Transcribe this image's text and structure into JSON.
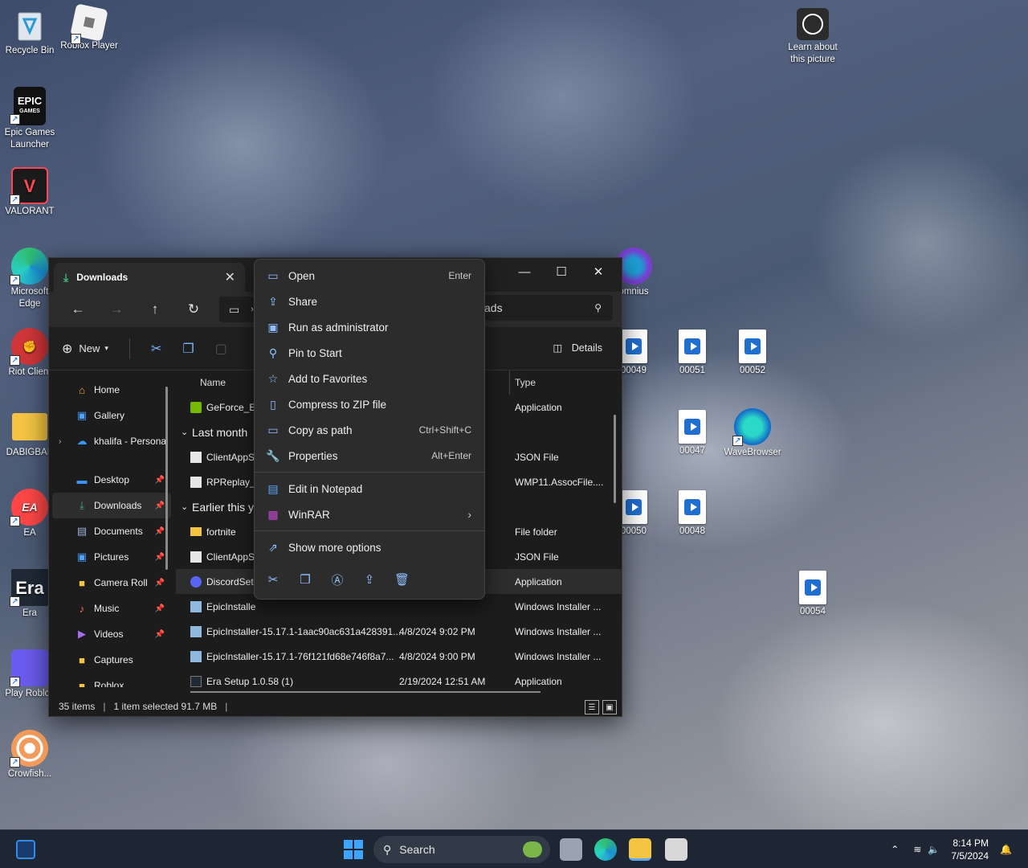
{
  "desktop_icons": [
    {
      "label": "Recycle Bin"
    },
    {
      "label": "Roblox Player"
    },
    {
      "label": "Epic Games Launcher"
    },
    {
      "label": "VALORANT"
    },
    {
      "label": "Microsoft Edge"
    },
    {
      "label": "Riot Client"
    },
    {
      "label": "DABIGBAE"
    },
    {
      "label": "EA"
    },
    {
      "label": "Era"
    },
    {
      "label": "Play Roblox"
    },
    {
      "label": "Crowfish..."
    },
    {
      "label": "Learn about this picture"
    },
    {
      "label": "omnius"
    },
    {
      "label": "00049"
    },
    {
      "label": "00051"
    },
    {
      "label": "00052"
    },
    {
      "label": "00047"
    },
    {
      "label": "WaveBrowser"
    },
    {
      "label": "00050"
    },
    {
      "label": "00048"
    },
    {
      "label": "00054"
    }
  ],
  "explorer": {
    "tab_title": "Downloads",
    "search_placeholder": "ads",
    "toolbar": {
      "new_label": "New",
      "details_label": "Details"
    },
    "sidebar": [
      {
        "label": "Home",
        "pinned": false
      },
      {
        "label": "Gallery",
        "pinned": false
      },
      {
        "label": "khalifa - Personal",
        "pinned": false
      },
      {
        "label": "Desktop",
        "pinned": true
      },
      {
        "label": "Downloads",
        "pinned": true
      },
      {
        "label": "Documents",
        "pinned": true
      },
      {
        "label": "Pictures",
        "pinned": true
      },
      {
        "label": "Camera Roll",
        "pinned": true
      },
      {
        "label": "Music",
        "pinned": true
      },
      {
        "label": "Videos",
        "pinned": true
      },
      {
        "label": "Captures",
        "pinned": false
      },
      {
        "label": "Roblox",
        "pinned": false
      }
    ],
    "columns": {
      "name": "Name",
      "type": "Type"
    },
    "groups": {
      "last_month": "Last month",
      "earlier_this_year": "Earlier this y"
    },
    "rows": [
      {
        "name": "GeForce_Ex",
        "date": "",
        "type": "Application"
      },
      {
        "name": "ClientAppS",
        "date": "",
        "type": "JSON File"
      },
      {
        "name": "RPReplay_F",
        "date": "",
        "type": "WMP11.AssocFile...."
      },
      {
        "name": "fortnite",
        "date": "",
        "type": "File folder"
      },
      {
        "name": "ClientAppS",
        "date": "",
        "type": "JSON File"
      },
      {
        "name": "DiscordSetu",
        "date": "",
        "type": "Application"
      },
      {
        "name": "EpicInstalle",
        "date": "",
        "type": "Windows Installer ..."
      },
      {
        "name": "EpicInstaller-15.17.1-1aac90ac631a428391...",
        "date": "4/8/2024 9:02 PM",
        "type": "Windows Installer ..."
      },
      {
        "name": "EpicInstaller-15.17.1-76f121fd68e746f8a7...",
        "date": "4/8/2024 9:00 PM",
        "type": "Windows Installer ..."
      },
      {
        "name": "Era Setup 1.0.58 (1)",
        "date": "2/19/2024 12:51 AM",
        "type": "Application"
      }
    ],
    "status": {
      "items": "35 items",
      "selected": "1 item selected 91.7 MB"
    }
  },
  "context_menu": {
    "items": [
      {
        "label": "Open",
        "shortcut": "Enter",
        "icon": "open-icon"
      },
      {
        "label": "Share",
        "shortcut": "",
        "icon": "share-icon"
      },
      {
        "label": "Run as administrator",
        "shortcut": "",
        "icon": "shield-icon"
      },
      {
        "label": "Pin to Start",
        "shortcut": "",
        "icon": "pin-icon"
      },
      {
        "label": "Add to Favorites",
        "shortcut": "",
        "icon": "star-icon"
      },
      {
        "label": "Compress to ZIP file",
        "shortcut": "",
        "icon": "zip-icon"
      },
      {
        "label": "Copy as path",
        "shortcut": "Ctrl+Shift+C",
        "icon": "path-icon"
      },
      {
        "label": "Properties",
        "shortcut": "Alt+Enter",
        "icon": "wrench-icon"
      }
    ],
    "edit_notepad": "Edit in Notepad",
    "winrar": "WinRAR",
    "show_more": "Show more options"
  },
  "taskbar": {
    "search_label": "Search",
    "time": "8:14 PM",
    "date": "7/5/2024"
  }
}
